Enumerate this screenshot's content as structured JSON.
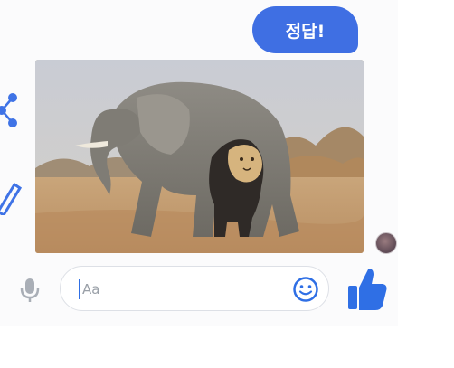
{
  "message": {
    "text": "정답!",
    "bubble_color": "#3f6fe3"
  },
  "image": {
    "subject": "elephant-and-lion-photo"
  },
  "side_actions": {
    "icons": [
      "share-icon",
      "edit-icon"
    ]
  },
  "composer": {
    "placeholder": "Aa",
    "mic_icon": "microphone-icon",
    "emoji_icon": "smiley-icon",
    "like_icon": "thumbs-up-icon",
    "accent_color": "#2f6fe5"
  }
}
